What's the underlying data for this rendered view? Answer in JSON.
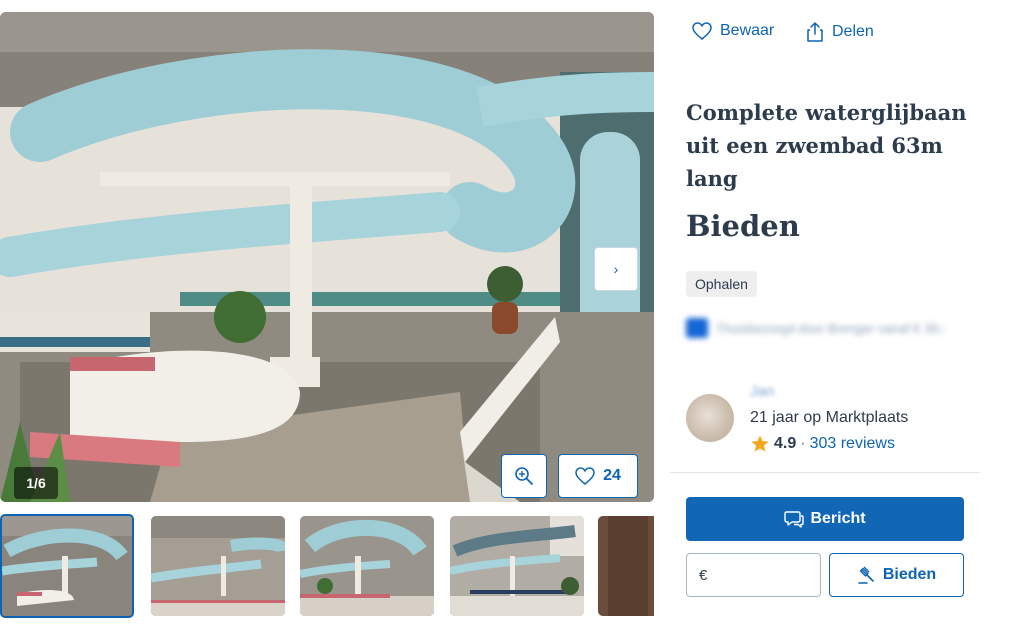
{
  "gallery": {
    "counter": "1/6",
    "favorites_count": "24",
    "thumbnails": [
      {
        "label": "thumbnail-1"
      },
      {
        "label": "thumbnail-2"
      },
      {
        "label": "thumbnail-3"
      },
      {
        "label": "thumbnail-4"
      },
      {
        "label": "thumbnail-5"
      }
    ]
  },
  "actions": {
    "save_label": "Bewaar",
    "share_label": "Delen"
  },
  "listing": {
    "title": "Complete waterglijbaan uit een zwembad 63m lang",
    "price": "Bieden",
    "delivery_badge": "Ophalen",
    "shipping_text": "Thuisbezorgd door Brenger vanaf € 39,-"
  },
  "seller": {
    "name": "Jan",
    "years": "21 jaar op Marktplaats",
    "rating": "4.9",
    "reviews": "303 reviews"
  },
  "contact": {
    "message_label": "Bericht",
    "bid_currency": "€",
    "bid_label": "Bieden"
  },
  "colors": {
    "brand": "#0d64b4",
    "star": "#f5a623"
  }
}
